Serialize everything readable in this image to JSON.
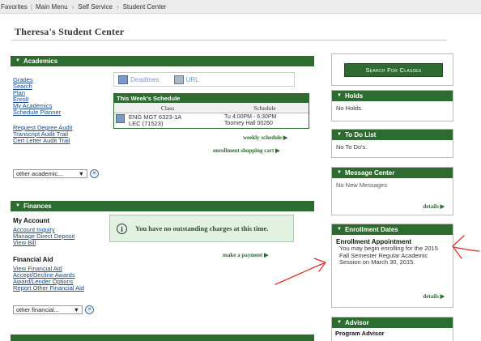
{
  "topnav": {
    "favorites": "Favorites",
    "main_menu": "Main Menu",
    "self_service": "Self Service",
    "student_center": "Student Center"
  },
  "page": {
    "title": "Theresa's Student Center"
  },
  "academics": {
    "header": "Academics",
    "links": [
      "Grades",
      "Search",
      "Plan",
      "Enroll",
      "My Academics",
      "Schedule Planner"
    ],
    "links2": [
      "Request Degree Audit",
      "Transcript Audit Trail",
      "Cert Letter Audit Trail"
    ],
    "tools": {
      "deadlines": "Deadlines",
      "url": "URL"
    },
    "schedule": {
      "title": "This Week's Schedule",
      "col_class": "Class",
      "col_schedule": "Schedule",
      "row_class_1": "ENG MGT 6323-1A",
      "row_class_2": "LEC (71523)",
      "row_sched_1": "Tu 4:00PM - 6:30PM",
      "row_sched_2": "Toomey Hall 00260"
    },
    "weekly_schedule": "weekly schedule",
    "enrollment_cart": "enrollment shopping cart",
    "dropdown": "other academic..."
  },
  "finances": {
    "header": "Finances",
    "my_account": "My Account",
    "account_links": [
      "Account Inquiry",
      "Manage Direct Deposit",
      "View Bill"
    ],
    "financial_aid": "Financial Aid",
    "aid_links": [
      "View Financial Aid",
      "Accept/Decline Awards",
      "Award/Lender Options",
      "Report Other Financial Aid"
    ],
    "notice": "You have no outstanding charges at this time.",
    "make_payment": "make a payment",
    "dropdown": "other financial..."
  },
  "sidebar": {
    "search_classes": "Search For Classes",
    "holds_header": "Holds",
    "holds_text": "No Holds.",
    "todo_header": "To Do List",
    "todo_text": "No To Do's.",
    "message_header": "Message Center",
    "message_text": "No New Messages",
    "message_details": "details",
    "enroll_header": "Enrollment Dates",
    "enroll_title": "Enrollment Appointment",
    "enroll_text": "You may begin enrolling for the 2015 Fall Semester Regular Academic Session on March 30, 2015.",
    "enroll_details": "details",
    "advisor_header": "Advisor",
    "advisor_text": "Program Advisor"
  },
  "colors": {
    "green": "#2e6b30",
    "link": "#1a4a8a",
    "annotation": "#e0302a"
  }
}
